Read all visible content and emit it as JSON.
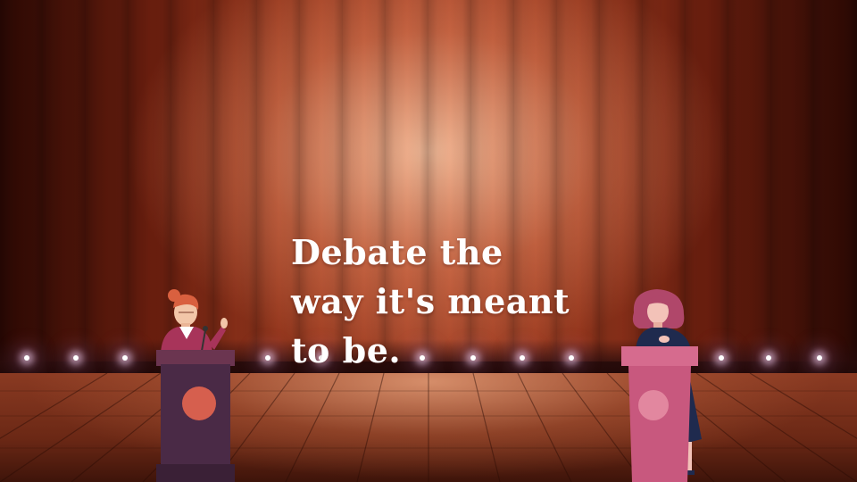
{
  "headline": {
    "line1": "Debate the",
    "line2": "way it's meant",
    "line3": "to be."
  },
  "colors": {
    "curtain": "#9a3a1f",
    "floor": "#6b2815",
    "left_podium": "#4a2a46",
    "left_podium_emblem": "#d65f4e",
    "right_podium": "#c8587e",
    "right_podium_emblem": "#e2879f",
    "left_speaker_top": "#a8345a",
    "right_speaker_top": "#1f2a4e",
    "left_speaker_hair": "#d9603f",
    "right_speaker_hair": "#b0476a"
  }
}
